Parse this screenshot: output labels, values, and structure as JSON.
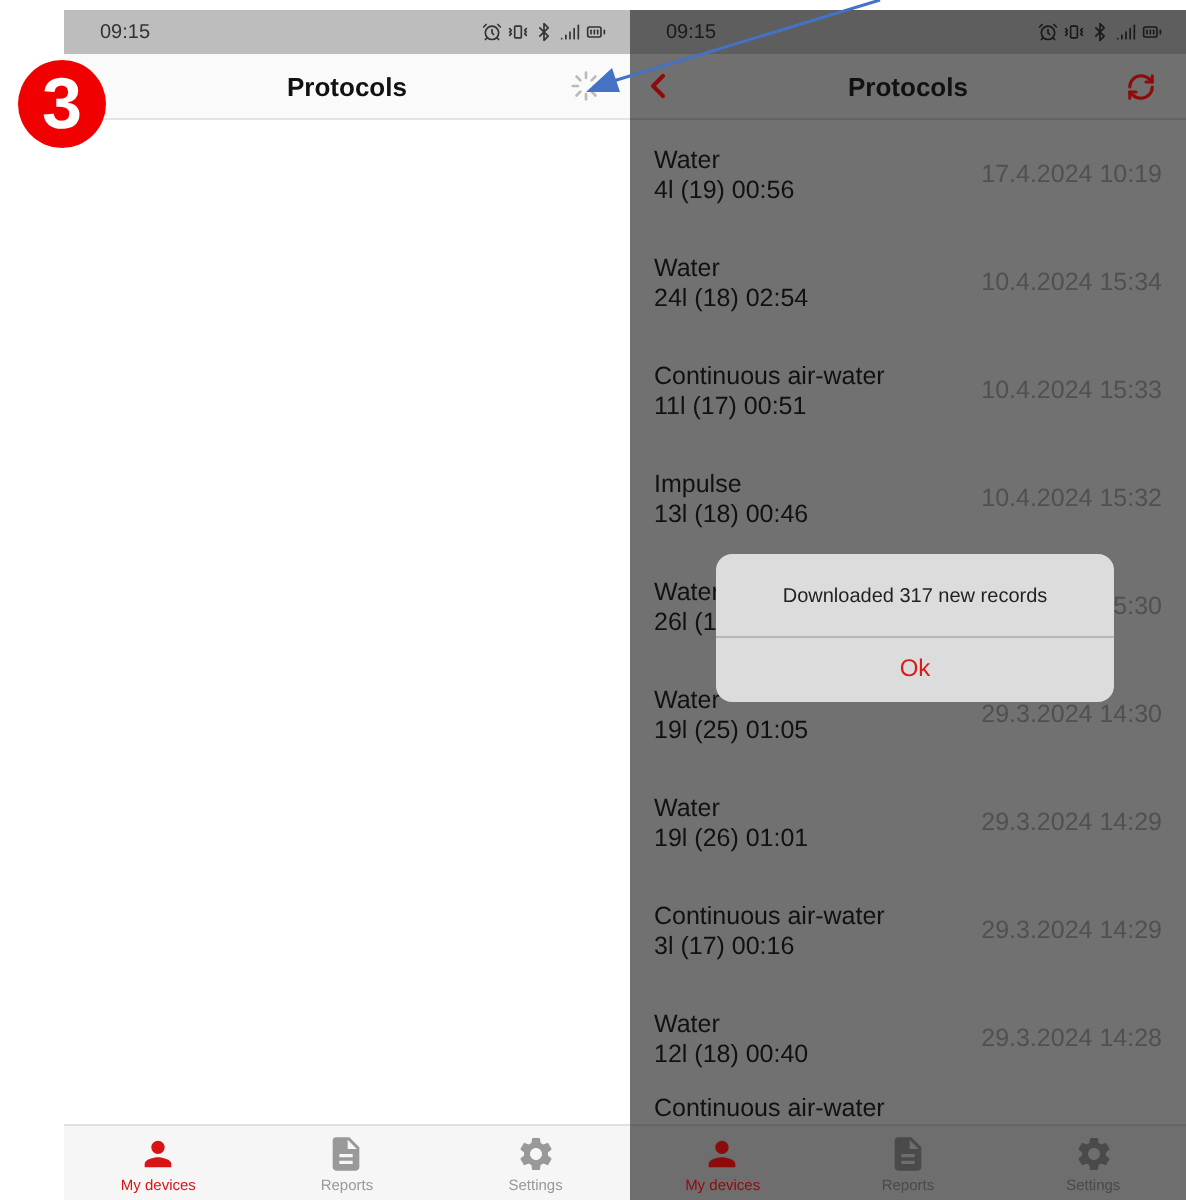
{
  "annotation": {
    "badge": "3"
  },
  "screens": [
    {
      "status_time": "09:15",
      "title": "Protocols",
      "loading": true,
      "dimmed": false,
      "nav": [
        {
          "label": "My devices",
          "kind": "person",
          "selected": true
        },
        {
          "label": "Reports",
          "kind": "document",
          "selected": false
        },
        {
          "label": "Settings",
          "kind": "gear",
          "selected": false
        }
      ]
    },
    {
      "status_time": "09:15",
      "title": "Protocols",
      "loading": false,
      "dimmed": true,
      "records": [
        {
          "title": "Water",
          "detail": "4l (19) 00:56",
          "date": "17.4.2024 10:19"
        },
        {
          "title": "Water",
          "detail": "24l (18) 02:54",
          "date": "10.4.2024 15:34"
        },
        {
          "title": "Continuous air-water",
          "detail": "11l (17) 00:51",
          "date": "10.4.2024 15:33"
        },
        {
          "title": "Impulse",
          "detail": "13l (18) 00:46",
          "date": "10.4.2024 15:32"
        },
        {
          "title": "Water",
          "detail": "26l (1",
          "date": "5:30"
        },
        {
          "title": "Water",
          "detail": "19l (25) 01:05",
          "date": "29.3.2024 14:30"
        },
        {
          "title": "Water",
          "detail": "19l (26) 01:01",
          "date": "29.3.2024 14:29"
        },
        {
          "title": "Continuous air-water",
          "detail": "3l (17) 00:16",
          "date": "29.3.2024 14:29"
        },
        {
          "title": "Water",
          "detail": "12l (18) 00:40",
          "date": "29.3.2024 14:28"
        },
        {
          "title": "Continuous air-water"
        }
      ],
      "dialog": {
        "message": "Downloaded 317 new records",
        "button": "Ok"
      },
      "nav": [
        {
          "label": "My devices",
          "kind": "person",
          "selected": true
        },
        {
          "label": "Reports",
          "kind": "document",
          "selected": false
        },
        {
          "label": "Settings",
          "kind": "gear",
          "selected": false
        }
      ]
    }
  ]
}
